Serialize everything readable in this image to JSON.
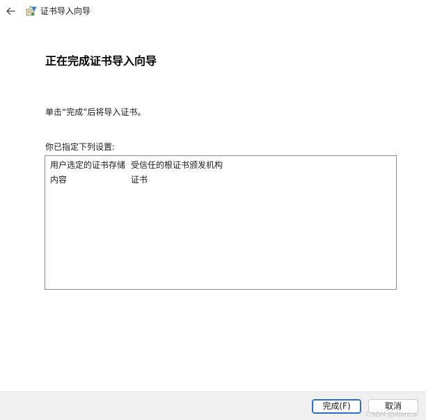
{
  "window": {
    "title": "证书导入向导"
  },
  "page": {
    "heading": "正在完成证书导入向导",
    "instruction": "单击“完成”后将导入证书。",
    "settings_label": "你已指定下列设置:"
  },
  "settings": [
    {
      "key": "用户选定的证书存储",
      "value": "受信任的根证书颁发机构"
    },
    {
      "key": "内容",
      "value": "证书"
    }
  ],
  "footer": {
    "finish_label": "完成(F)",
    "cancel_label": "取消",
    "watermark": "CSDN @AlanLai"
  },
  "icons": {
    "back": "back-arrow-icon",
    "app": "certificate-wizard-icon"
  },
  "colors": {
    "accent_border": "#2c6fc9",
    "footer_bg": "#f0f0f0"
  }
}
